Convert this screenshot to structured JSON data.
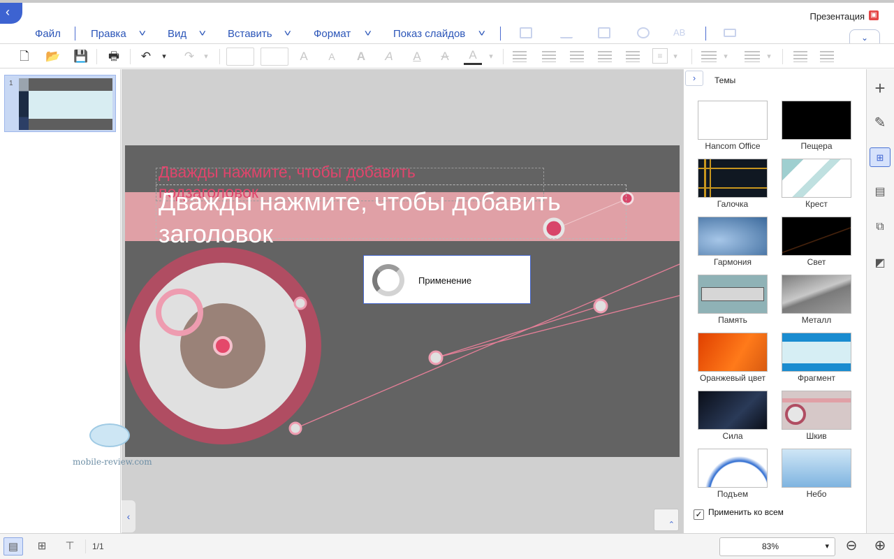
{
  "app": {
    "document_type_label": "Презентация"
  },
  "menu": {
    "items": [
      "Файл",
      "Правка",
      "Вид",
      "Вставить",
      "Формат",
      "Показ слайдов"
    ]
  },
  "slide": {
    "subtitle_placeholder": "Дважды нажмите, чтобы добавить подзаголовок",
    "title_placeholder": "Дважды нажмите, чтобы добавить заголовок"
  },
  "progress_dialog": {
    "text": "Применение"
  },
  "slides_panel": {
    "slide_number": "1"
  },
  "themes_panel": {
    "title": "Темы",
    "themes": [
      {
        "name": "Hancom Office",
        "style": "white"
      },
      {
        "name": "Пещера",
        "style": "black"
      },
      {
        "name": "Галочка",
        "style": "dark-gold"
      },
      {
        "name": "Крест",
        "style": "light-cross"
      },
      {
        "name": "Гармония",
        "style": "blue-harmony"
      },
      {
        "name": "Свет",
        "style": "dark-light"
      },
      {
        "name": "Память",
        "style": "memory"
      },
      {
        "name": "Металл",
        "style": "metal"
      },
      {
        "name": "Оранжевый цвет",
        "style": "orange"
      },
      {
        "name": "Фрагмент",
        "style": "fragment"
      },
      {
        "name": "Сила",
        "style": "power"
      },
      {
        "name": "Шкив",
        "style": "pulley"
      },
      {
        "name": "Подъем",
        "style": "rise"
      },
      {
        "name": "Небо",
        "style": "sky"
      }
    ],
    "apply_all_label": "Применить ко всем",
    "apply_all_checked": true
  },
  "statusbar": {
    "page_count": "1/1",
    "zoom": "83%"
  },
  "watermark": {
    "text": "mobile-review.com"
  },
  "colors": {
    "accent": "#3d63d1",
    "menu_text": "#2b55b8",
    "slide_background": "#636363",
    "title_band": "#e0a0a6",
    "subtitle_text": "#e0456c"
  }
}
